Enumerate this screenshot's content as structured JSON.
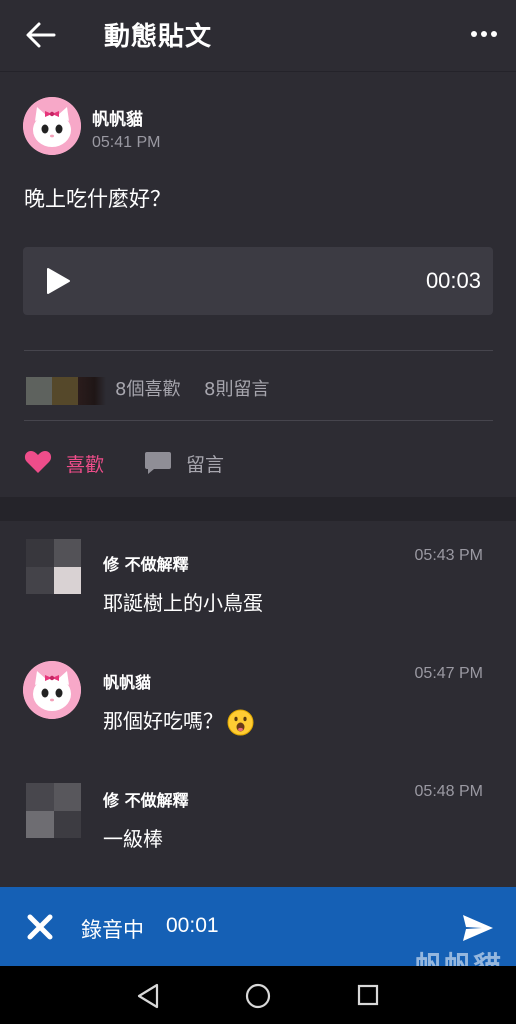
{
  "header": {
    "title": "動態貼文",
    "back_icon": "arrow-left-icon",
    "more_icon": "more-horizontal-icon"
  },
  "post": {
    "author": "帆帆貓",
    "time": "05:41 PM",
    "text": "晚上吃什麼好？",
    "audio": {
      "duration": "00:03",
      "play_icon": "play-icon"
    },
    "likes_text": "8個喜歡",
    "comments_text": "8則留言",
    "actions": {
      "like_label": "喜歡",
      "comment_label": "留言"
    }
  },
  "comments": [
    {
      "author": "修 不做解釋",
      "time": "05:43 PM",
      "text": "耶誕樹上的小鳥蛋"
    },
    {
      "author": "帆帆貓",
      "time": "05:47 PM",
      "text": "那個好吃嗎？",
      "emoji": "drooling-face-icon"
    },
    {
      "author": "修 不做解釋",
      "time": "05:48 PM",
      "text": "一級棒"
    }
  ],
  "recording": {
    "status": "錄音中",
    "timer": "00:01",
    "cancel_icon": "close-icon",
    "send_icon": "send-icon"
  },
  "watermark": "帆帆貓",
  "colors": {
    "background": "#2d2c33",
    "audio_player": "#3c3b43",
    "like_accent": "#ee4d8a",
    "record_bar": "#1560b5"
  }
}
